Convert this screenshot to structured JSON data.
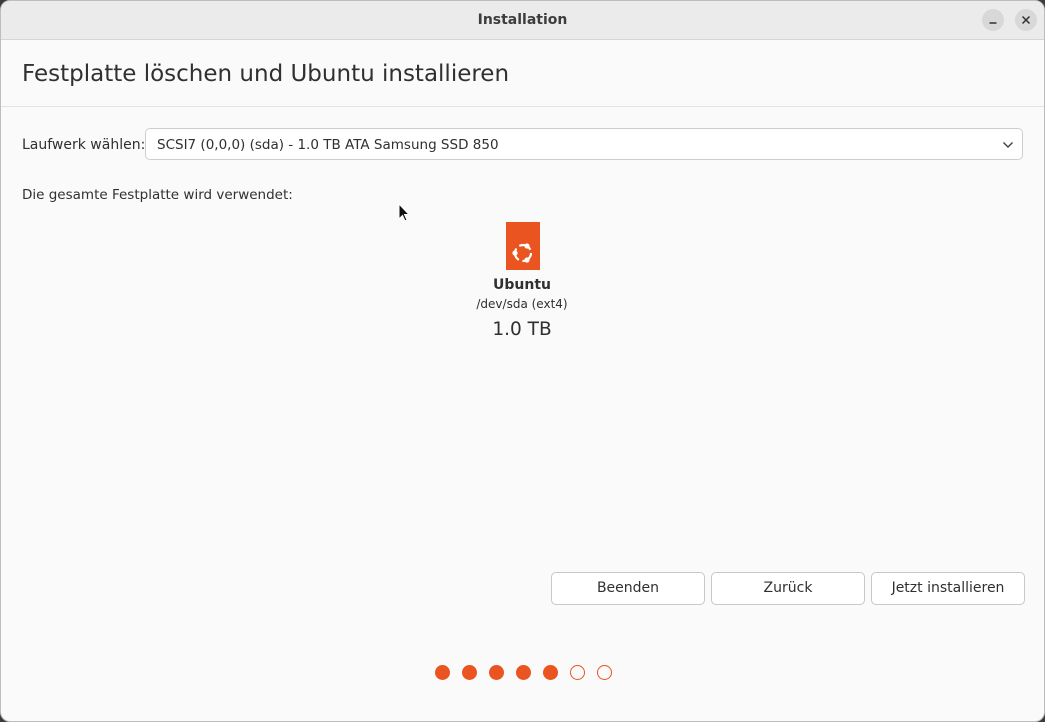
{
  "window": {
    "title": "Installation",
    "minimize_icon": "minimize-icon",
    "close_icon": "close-icon"
  },
  "page": {
    "title": "Festplatte löschen und Ubuntu installieren"
  },
  "drive": {
    "label": "Laufwerk wählen:",
    "selected": "SCSI7 (0,0,0) (sda) - 1.0 TB ATA Samsung SSD 850",
    "icon": "chevron-down-icon"
  },
  "disk": {
    "info": "Die gesamte Festplatte wird verwendet:",
    "partition": {
      "icon": "ubuntu-logo-icon",
      "name": "Ubuntu",
      "device": "/dev/sda (ext4)",
      "size": "1.0 TB"
    }
  },
  "buttons": {
    "quit": "Beenden",
    "back": "Zurück",
    "install": "Jetzt installieren"
  },
  "progress": {
    "total_steps": 7,
    "completed_steps": 5
  },
  "colors": {
    "accent": "#e95420"
  }
}
